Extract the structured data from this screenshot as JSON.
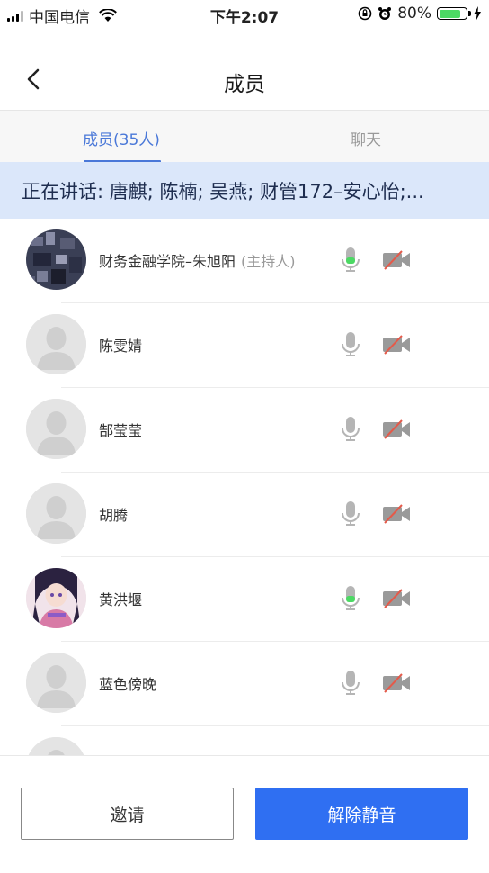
{
  "status_bar": {
    "carrier": "中国电信",
    "time": "下午2:07",
    "battery": "80%",
    "battery_level": 0.8
  },
  "nav": {
    "title": "成员"
  },
  "tabs": [
    {
      "label": "成员(35人)",
      "active": true
    },
    {
      "label": "聊天",
      "active": false
    }
  ],
  "speaking": {
    "text": "正在讲话: 唐麒; 陈楠; 吴燕; 财管172–安心怡;..."
  },
  "members": [
    {
      "name": "财务金融学院–朱旭阳",
      "tag": "(主持人)",
      "avatar": "photo-dark",
      "mic": "active",
      "camera": "off"
    },
    {
      "name": "陈雯婧",
      "tag": "",
      "avatar": "default",
      "mic": "idle",
      "camera": "off"
    },
    {
      "name": "郜莹莹",
      "tag": "",
      "avatar": "default",
      "mic": "idle",
      "camera": "off"
    },
    {
      "name": "胡腾",
      "tag": "",
      "avatar": "default",
      "mic": "idle",
      "camera": "off"
    },
    {
      "name": "黄洪堰",
      "tag": "",
      "avatar": "anime",
      "mic": "active",
      "camera": "off"
    },
    {
      "name": "蓝色傍晚",
      "tag": "",
      "avatar": "default",
      "mic": "idle",
      "camera": "off"
    },
    {
      "name": "",
      "tag": "",
      "avatar": "default",
      "mic": "idle",
      "camera": "off"
    }
  ],
  "buttons": {
    "invite": "邀请",
    "unmute": "解除静音"
  },
  "colors": {
    "accent": "#4a78d8",
    "primary_button": "#2f6ff2",
    "speaking_banner": "#dbe7fa",
    "mic_active": "#4cd964"
  }
}
